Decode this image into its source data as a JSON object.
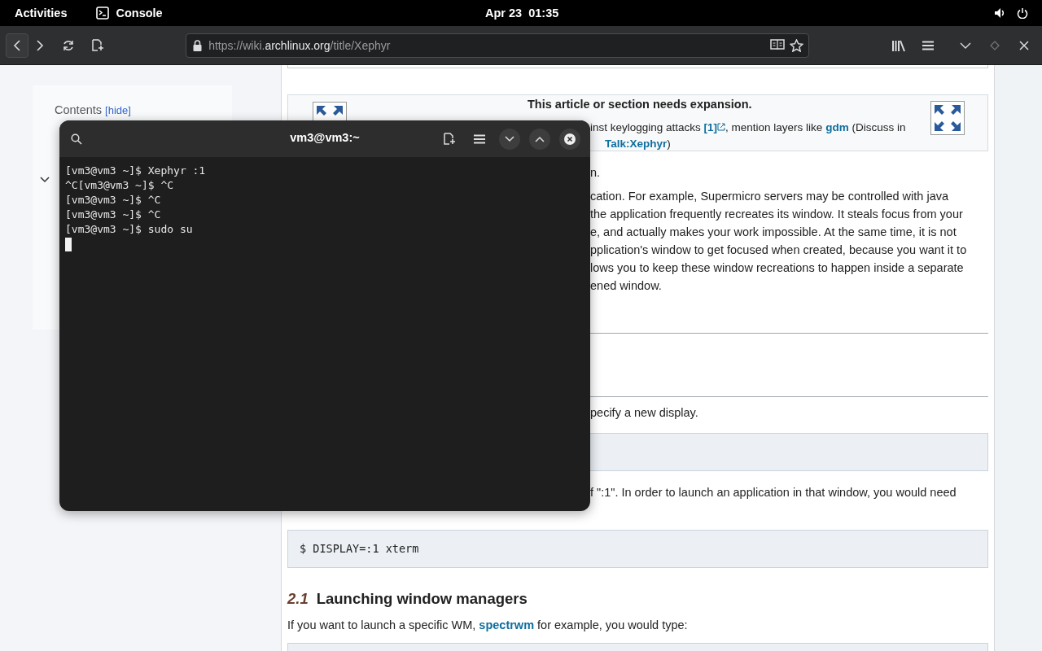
{
  "top_bar": {
    "activities": "Activities",
    "app": "Console",
    "clock": "Apr 23  01:35"
  },
  "browser": {
    "url": [
      {
        "text": "https://wiki.",
        "kind": "dim"
      },
      {
        "text": "archlinux.org",
        "kind": "host"
      },
      {
        "text": "/title/Xephyr",
        "kind": "dim"
      }
    ]
  },
  "sidebar": {
    "heading": "Contents",
    "toggle": "[hide]"
  },
  "article": {
    "banner": {
      "title": "This article or section needs expansion.",
      "lines": [
        [
          {
            "kind": "text",
            "text": "inst keylogging attacks "
          },
          {
            "kind": "extlink",
            "text": "[1]"
          },
          {
            "kind": "text",
            "text": ", mention layers like "
          },
          {
            "kind": "link",
            "text": "gdm"
          },
          {
            "kind": "text",
            "text": " (Discuss in"
          }
        ],
        [
          {
            "kind": "link",
            "text": "Talk:Xephyr"
          },
          {
            "kind": "text",
            "text": ")"
          }
        ]
      ]
    },
    "blocks": [
      {
        "kind": "para",
        "lines": [
          [
            {
              "kind": "text",
              "text": "n."
            }
          ]
        ]
      },
      {
        "kind": "para",
        "lines": [
          [
            {
              "kind": "text",
              "text": "cation. For example, Supermicro servers may be controlled with java"
            }
          ],
          [
            {
              "kind": "text",
              "text": "the application frequently recreates its window. It steals focus from your"
            }
          ],
          [
            {
              "kind": "text",
              "text": "e, and actually makes your work impossible. At the same time, it is not"
            }
          ],
          [
            {
              "kind": "text",
              "text": "pplication's window to get focused when created, because you want it to"
            }
          ],
          [
            {
              "kind": "text",
              "text": "lows you to keep these window recreations to happen inside a separate"
            }
          ],
          [
            {
              "kind": "text",
              "text": "ened window."
            }
          ]
        ]
      },
      {
        "kind": "rule"
      },
      {
        "kind": "rule"
      },
      {
        "kind": "para",
        "lines": [
          [
            {
              "kind": "text",
              "text": "pecify a new display."
            }
          ]
        ]
      },
      {
        "kind": "code"
      },
      {
        "kind": "para",
        "lines": [
          [
            {
              "kind": "text",
              "text": "f \":1\". In order to launch an application in that window, you would need"
            }
          ]
        ]
      },
      {
        "kind": "code",
        "text": "$ DISPLAY=:1 xterm"
      },
      {
        "kind": "heading",
        "number": "2.1",
        "title": "Launching window managers"
      },
      {
        "kind": "para",
        "lines": [
          [
            {
              "kind": "text",
              "text": "If you want to launch a specific WM, "
            },
            {
              "kind": "link",
              "text": "spectrwm"
            },
            {
              "kind": "text",
              "text": " for example, you would type:"
            }
          ]
        ]
      },
      {
        "kind": "code"
      }
    ]
  },
  "terminal": {
    "title": "vm3@vm3:~",
    "lines": [
      "[vm3@vm3 ~]$ Xephyr :1",
      "^C[vm3@vm3 ~]$ ^C",
      "[vm3@vm3 ~]$ ^C",
      "[vm3@vm3 ~]$ ^C",
      "[vm3@vm3 ~]$ sudo su"
    ],
    "cursor": true
  }
}
